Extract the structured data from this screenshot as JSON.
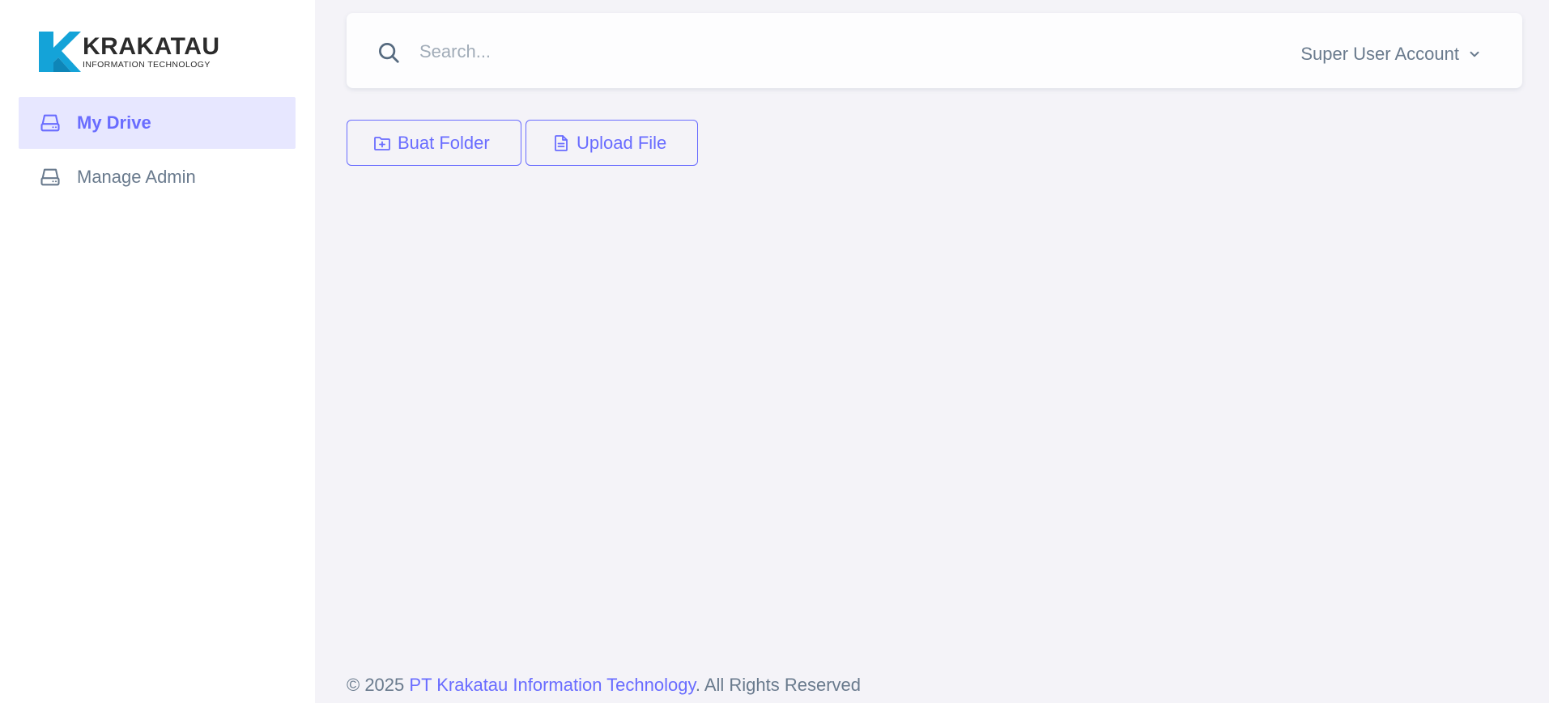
{
  "brand": {
    "name": "KRAKATAU",
    "subtitle": "INFORMATION TECHNOLOGY",
    "primary_color": "#14a3d8",
    "accent_color": "#696cff"
  },
  "sidebar": {
    "items": [
      {
        "label": "My Drive",
        "icon": "hard-drive-icon",
        "active": true
      },
      {
        "label": "Manage Admin",
        "icon": "hard-drive-icon",
        "active": false
      }
    ]
  },
  "navbar": {
    "search_placeholder": "Search...",
    "search_value": "",
    "account_label": "Super User Account"
  },
  "actions": {
    "create_folder_label": "Buat Folder",
    "upload_file_label": "Upload File"
  },
  "footer": {
    "prefix": "© 2025 ",
    "company": "PT Krakatau Information Technology",
    "suffix": ". All Rights Reserved"
  }
}
